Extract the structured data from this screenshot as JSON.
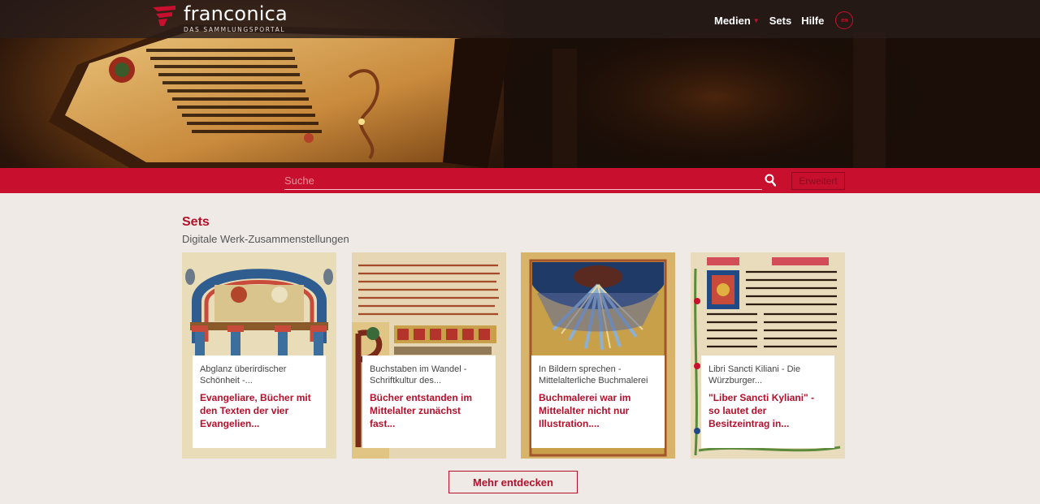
{
  "brand": {
    "name": "franconica",
    "tagline": "DAS SAMMLUNGSPORTAL"
  },
  "nav": {
    "items": [
      {
        "label": "Medien",
        "has_dropdown": true
      },
      {
        "label": "Sets"
      },
      {
        "label": "Hilfe"
      }
    ],
    "lang": "en"
  },
  "search": {
    "placeholder": "Suche",
    "advanced_label": "Erweitert"
  },
  "sets": {
    "title": "Sets",
    "subtitle": "Digitale Werk-Zusammenstellungen",
    "cards": [
      {
        "series": "Abglanz überirdischer Schönheit -...",
        "title": "Evangeliare, Bücher mit den Texten der vier Evangelien..."
      },
      {
        "series": "Buchstaben im Wandel - Schriftkultur des...",
        "title": "Bücher entstanden im Mittelalter zunächst fast..."
      },
      {
        "series": "In Bildern sprechen - Mittelalterliche Buchmalerei",
        "title": "Buchmalerei war im Mittelalter nicht nur Illustration...."
      },
      {
        "series": "Libri Sancti Kiliani - Die Würzburger...",
        "title": "\"Liber Sancti Kyliani\" - so lautet der Besitzeintrag in..."
      }
    ],
    "more_label": "Mehr entdecken"
  },
  "colors": {
    "accent": "#c8102e",
    "background": "#efeae6"
  }
}
